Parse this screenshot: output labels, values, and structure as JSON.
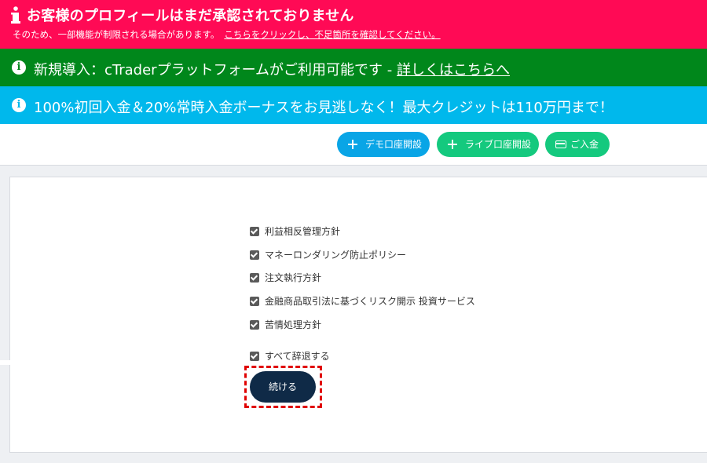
{
  "profile_banner": {
    "title": "お客様のプロフィールはまだ承認されておりません",
    "subtitle": "そのため、一部機能が制限される場合があります。",
    "link": "こちらをクリックし、不足箇所を確認してください。",
    "color": "#ff0a55"
  },
  "ctrader_banner": {
    "text": "新規導入：cTraderプラットフォームがご利用可能です - ",
    "link": "詳しくはこちらへ",
    "color": "#00871b"
  },
  "bonus_banner": {
    "text": "100%初回入金＆20%常時入金ボーナスをお見逃しなく！最大クレジットは110万円まで！",
    "color": "#00b8ec"
  },
  "actions": {
    "demo_label": "デモ口座開設",
    "live_label": "ライブ口座開設",
    "deposit_label": "ご入金"
  },
  "policies": [
    {
      "label": "利益相反管理方針",
      "checked": true
    },
    {
      "label": "マネーロンダリング防止ポリシー",
      "checked": true
    },
    {
      "label": "注文執行方針",
      "checked": true
    },
    {
      "label": "金融商品取引法に基づくリスク開示 投資サービス",
      "checked": true
    },
    {
      "label": "苦情処理方針",
      "checked": true
    }
  ],
  "decline_all": {
    "label": "すべて辞退する",
    "checked": true
  },
  "continue_label": "続ける"
}
